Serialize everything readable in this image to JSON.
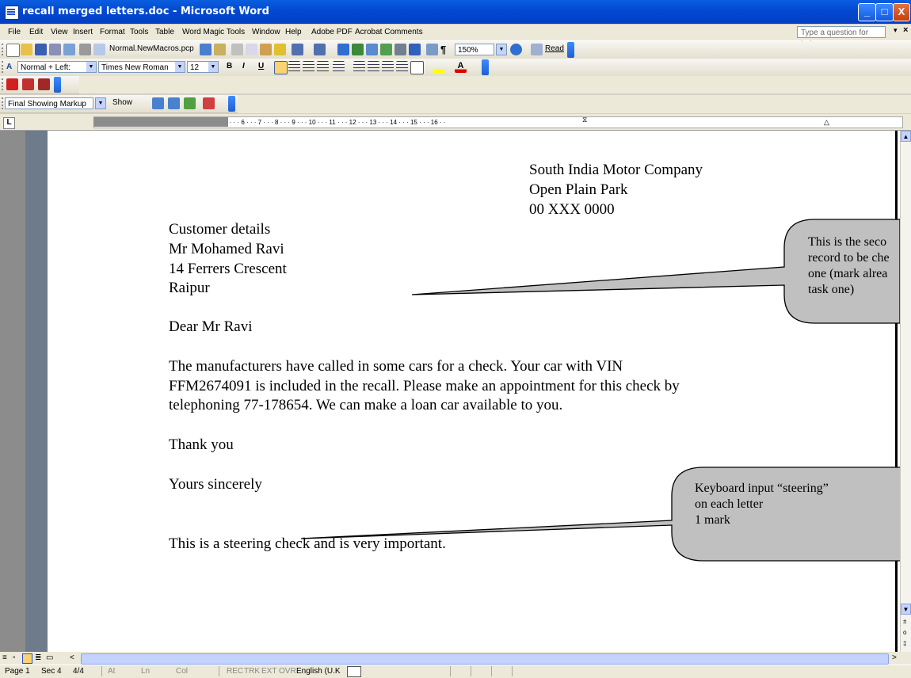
{
  "window": {
    "title": "recall merged letters.doc - Microsoft Word",
    "min_glyph": "_",
    "max_glyph": "□",
    "close_glyph": "X"
  },
  "menu": {
    "items": [
      "File",
      "Edit",
      "View",
      "Insert",
      "Format",
      "Tools",
      "Table",
      "Word Magic Tools",
      "Window",
      "Help",
      "Adobe PDF",
      "Acrobat Comments"
    ],
    "help_placeholder": "Type a question for help",
    "close_glyph": "×"
  },
  "toolbar_standard": {
    "template": "Normal.NewMacros.pcp",
    "zoom": "150%",
    "read_label": "Read"
  },
  "toolbar_formatting": {
    "style": "Normal + Left:",
    "font": "Times New Roman",
    "size": "12",
    "bold": "B",
    "italic": "I",
    "underline": "U"
  },
  "toolbar_reviewing": {
    "display": "Final Showing Markup",
    "show_label": "Show"
  },
  "ruler": {
    "text": "3 · · · 2 · · · 1 · · · · · · 1 · · · 2 · · · 3 · · · 4 · · · 5 · · · 6 · · · 7 · · · 8 · · · 9 · · · 10 · · · 11 · · · 12 · · · 13 · · · 14 · · · 15 · · · 16 · ·",
    "tab_glyph": "L"
  },
  "letter": {
    "company": "South India Motor Company",
    "address1": "Open Plain Park",
    "postcode": "00 XXX 0000",
    "customer_heading": "Customer details",
    "customer_name": "Mr Mohamed Ravi",
    "customer_street": "14 Ferrers Crescent",
    "customer_city": "Raipur",
    "salutation": "Dear Mr Ravi",
    "body1": "The manufacturers have called in some cars for a check.  Your car with VIN",
    "body2": "FFM2674091 is included in the recall. Please make an appointment for this check by",
    "body3": "telephoning 77-178654. We can make a loan car available to you.",
    "thanks": "Thank you",
    "closing": "Yours sincerely",
    "footnote": "This is a steering check and is very important."
  },
  "callouts": {
    "one": [
      "This is the seco",
      "record to be che",
      "one (mark alrea",
      "task one)"
    ],
    "two": [
      "Keyboard input “steering”",
      "on each letter",
      "1 mark"
    ]
  },
  "status": {
    "page": "Page 1",
    "sec": "Sec 4",
    "pages": "4/4",
    "at": "At",
    "ln": "Ln",
    "col": "Col",
    "rec": "REC",
    "trk": "TRK",
    "ext": "EXT",
    "ovr": "OVR",
    "language": "English (U.K"
  }
}
